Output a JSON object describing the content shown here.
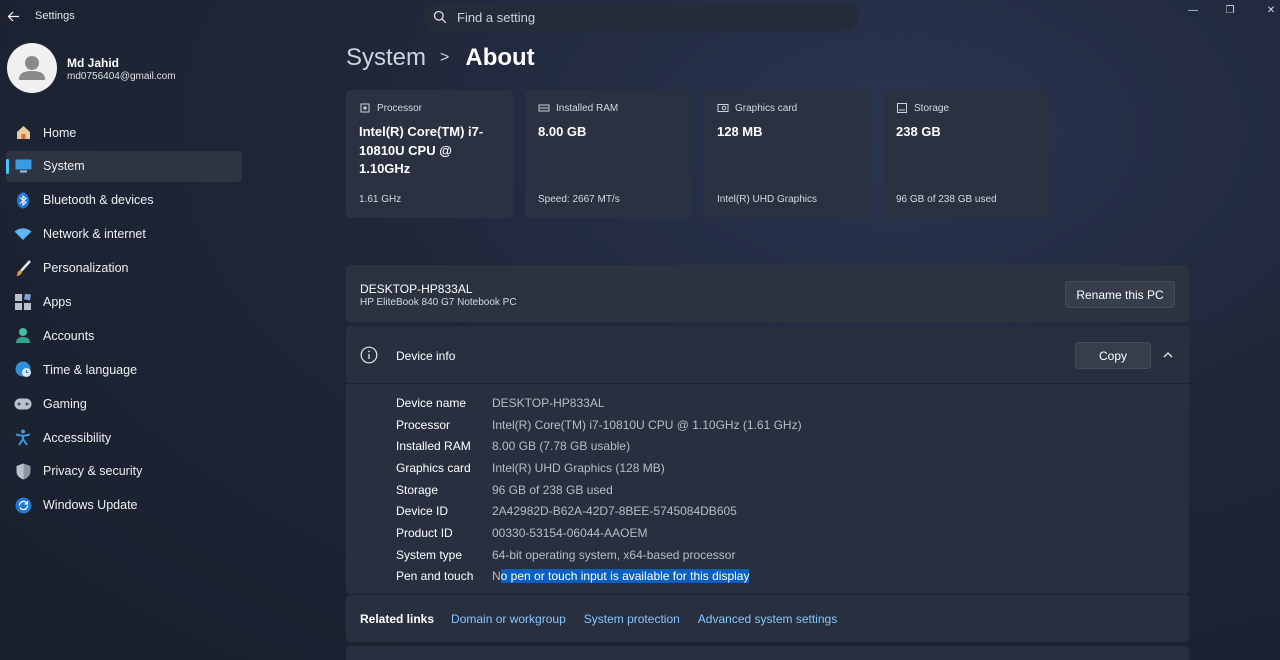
{
  "window": {
    "title": "Settings",
    "controls": {
      "minimize": "—",
      "maximize": "❐",
      "close": "✕"
    }
  },
  "search": {
    "placeholder": "Find a setting"
  },
  "user": {
    "name": "Md Jahid",
    "email": "md0756404@gmail.com"
  },
  "nav": {
    "items": [
      {
        "label": "Home",
        "icon": "home-icon"
      },
      {
        "label": "System",
        "icon": "system-icon",
        "active": true
      },
      {
        "label": "Bluetooth & devices",
        "icon": "bluetooth-icon"
      },
      {
        "label": "Network & internet",
        "icon": "wifi-icon"
      },
      {
        "label": "Personalization",
        "icon": "brush-icon"
      },
      {
        "label": "Apps",
        "icon": "apps-icon"
      },
      {
        "label": "Accounts",
        "icon": "accounts-icon"
      },
      {
        "label": "Time & language",
        "icon": "globe-clock-icon"
      },
      {
        "label": "Gaming",
        "icon": "gamepad-icon"
      },
      {
        "label": "Accessibility",
        "icon": "accessibility-icon"
      },
      {
        "label": "Privacy & security",
        "icon": "shield-icon"
      },
      {
        "label": "Windows Update",
        "icon": "update-icon"
      }
    ]
  },
  "breadcrumb": {
    "parent": "System",
    "separator": ">",
    "current": "About"
  },
  "specs": [
    {
      "label": "Processor",
      "value": "Intel(R) Core(TM) i7-10810U CPU @ 1.10GHz",
      "sub": "1.61 GHz",
      "icon": "processor-icon"
    },
    {
      "label": "Installed RAM",
      "value": "8.00 GB",
      "sub": "Speed: 2667 MT/s",
      "icon": "ram-icon"
    },
    {
      "label": "Graphics card",
      "value": "128 MB",
      "sub": "Intel(R) UHD Graphics",
      "icon": "graphics-card-icon"
    },
    {
      "label": "Storage",
      "value": "238 GB",
      "sub": "96 GB of 238 GB used",
      "icon": "storage-icon"
    }
  ],
  "pc": {
    "name": "DESKTOP-HP833AL",
    "model": "HP EliteBook 840 G7 Notebook PC",
    "rename_label": "Rename this PC"
  },
  "device_info": {
    "title": "Device info",
    "copy_label": "Copy",
    "rows": [
      {
        "key": "Device name",
        "value": "DESKTOP-HP833AL"
      },
      {
        "key": "Processor",
        "value": "Intel(R) Core(TM) i7-10810U CPU @ 1.10GHz (1.61 GHz)"
      },
      {
        "key": "Installed RAM",
        "value": "8.00 GB (7.78 GB usable)"
      },
      {
        "key": "Graphics card",
        "value": "Intel(R) UHD Graphics (128 MB)"
      },
      {
        "key": "Storage",
        "value": "96 GB of 238 GB used"
      },
      {
        "key": "Device ID",
        "value": "2A42982D-B62A-42D7-8BEE-5745084DB605"
      },
      {
        "key": "Product ID",
        "value": "00330-53154-06044-AAOEM"
      },
      {
        "key": "System type",
        "value": "64-bit operating system, x64-based processor"
      },
      {
        "key": "Pen and touch",
        "value_plain": "N",
        "value_selected": "o pen or touch input is available for this display"
      }
    ]
  },
  "related_links": {
    "label": "Related links",
    "links": [
      "Domain or workgroup",
      "System protection",
      "Advanced system settings"
    ]
  },
  "colors": {
    "accent": "#4cc2ff",
    "link": "#86c6ff",
    "selection": "#0a5fc0"
  }
}
